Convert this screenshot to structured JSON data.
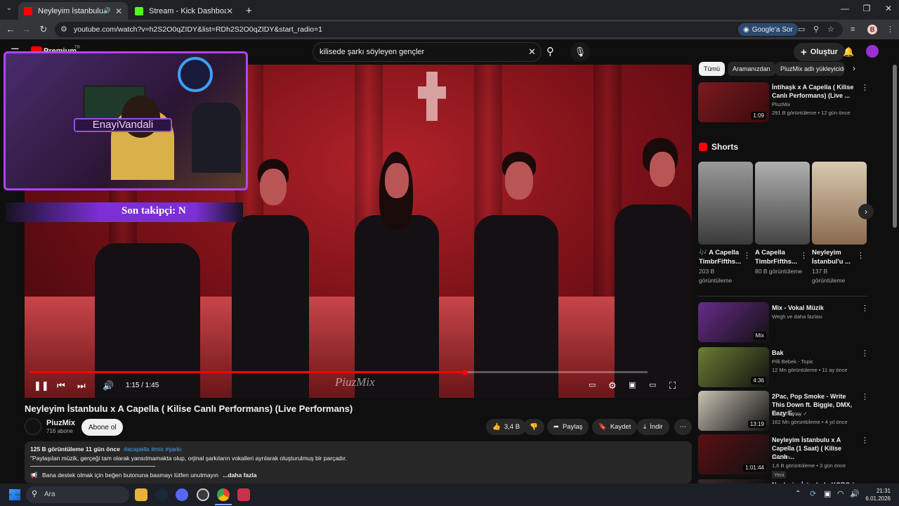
{
  "browser": {
    "tabs": [
      {
        "title": "Neyleyim İstanbulu x A Cap",
        "active": true,
        "favicon_color": "#ff0000"
      },
      {
        "title": "Stream - Kick Dashboard",
        "active": false,
        "favicon_color": "#53fc18"
      }
    ],
    "new_tab": "+",
    "url": "youtube.com/watch?v=h2S2O0qZIDY&list=RDh2S2O0qZIDY&start_radio=1",
    "google_ask": "Google'a Sor",
    "profile_initial": "B"
  },
  "youtube": {
    "logo_text": "Premium",
    "logo_sup": "TR",
    "search_value": "kilisede şarkı söyleyen gençler",
    "create_label": "Oluştur"
  },
  "player": {
    "overlay_name": "EnayiVandali",
    "follower_text": "Son takipçi: N",
    "time": "1:15 / 1:45",
    "progress": 0.705,
    "watermark": "PiuzMix"
  },
  "video": {
    "title": "Neyleyim İstanbulu x A Capella ( Kilise Canlı Performans) (Live Performans)",
    "channel": "PiuzMix",
    "subscribers": "716 abone",
    "subscribe": "Abone ol",
    "likes": "3,4 B",
    "share": "Paylaş",
    "save": "Kaydet",
    "download": "İndir",
    "desc_stats": "125 B görüntüleme  11 gün önce",
    "desc_tags": "#acapella #mix #şarkı",
    "desc_line1": "\"Paylaşılan müzik, gerçeği tam olarak yansıtmamakta olup, orjinal şarkıların vokalleri ayrılarak oluşturulmuş bir parçadır.",
    "desc_line2": "Bana destek olmak için  beğen butonuna basmayı lütfen unutmayın",
    "desc_more": "...daha fazla"
  },
  "sidebar": {
    "chips": [
      "Tümü",
      "Aramanızdan",
      "PluzMix adlı yükleyiciden"
    ],
    "top_video": {
      "title": "İntihaşk x A Capella ( Kilise Canlı Performans) (Live ...",
      "channel": "PluzMix",
      "meta": "291 B görüntüleme • 12 gün önce",
      "duration": "1:09"
    },
    "shorts_heading": "Shorts",
    "shorts": [
      {
        "title": "🎶 A Capella TimbrFifths...",
        "views": "203 B görüntüleme"
      },
      {
        "title": "A Capella TimbrFifths...",
        "views": "80 B görüntüleme"
      },
      {
        "title": "Neyleyim İstanbul'u ...",
        "views": "137 B görüntüleme"
      }
    ],
    "videos": [
      {
        "title": "Mix - Vokal Müzik",
        "channel": "Wegh ve daha fazlası",
        "meta": "",
        "badge": "Mix",
        "thumb": "#6a2a8a"
      },
      {
        "title": "Bak",
        "channel": "Pilli Bebek - Topic",
        "meta": "12 Mn görüntüleme • 11 ay önce",
        "badge": "4:36",
        "thumb": "#6b7d34"
      },
      {
        "title": "2Pac, Pop Smoke - Write This Down ft. Biggie, DMX, Eazy E, ...",
        "channel": "Thug Theory ✓",
        "meta": "162 Mn görüntüleme • 4 yıl önce",
        "badge": "13:19",
        "thumb": "#c9c2b4"
      },
      {
        "title": "Neyleyim İstanbulu x A Capella (1 Saat) ( Kilise Canlı ...",
        "channel": "PluzMix",
        "meta": "1,6 B görüntüleme • 3 gün önce",
        "badge": "1:01:44",
        "thumb": "#5a1014",
        "tag": "Yeni"
      },
      {
        "title": "Neyleyim İstanbulu KORO /",
        "channel": "",
        "meta": "",
        "badge": "",
        "thumb": "#3a2a2a"
      }
    ]
  },
  "taskbar": {
    "search": "Ara",
    "time": "21:31",
    "date": "6.01.2026"
  },
  "colors": {
    "accent": "#ff0000",
    "overlay_border": "#b044ff"
  }
}
